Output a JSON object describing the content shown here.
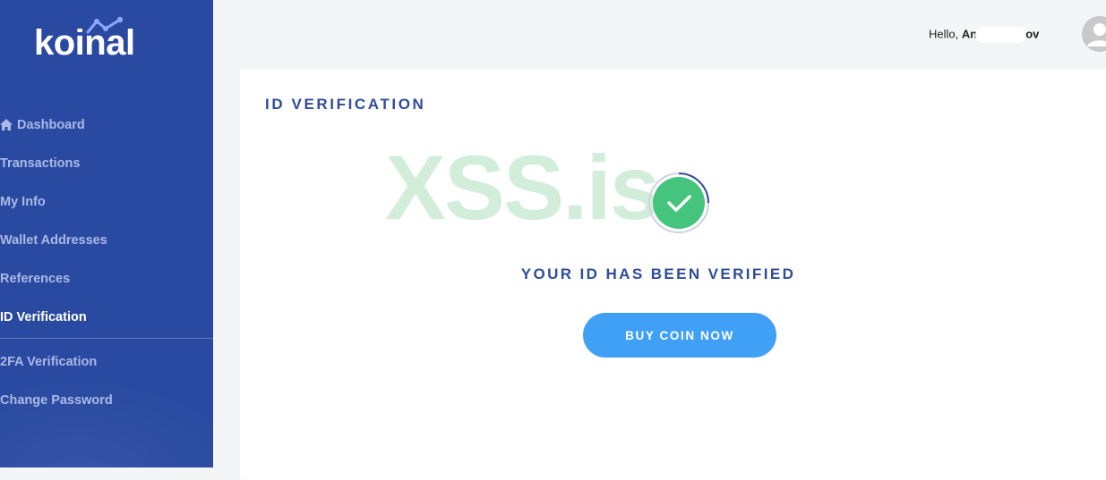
{
  "brand": {
    "name": "koinal"
  },
  "sidebar": {
    "items": [
      {
        "label": "Dashboard",
        "icon": "home-icon"
      },
      {
        "label": "Transactions"
      },
      {
        "label": "My Info"
      },
      {
        "label": "Wallet Addresses"
      },
      {
        "label": "References"
      },
      {
        "label": "ID Verification",
        "active": true
      },
      {
        "label": "2FA Verification"
      },
      {
        "label": "Change Password"
      }
    ]
  },
  "header": {
    "greeting_prefix": "Hello,",
    "user_name_start": "An",
    "user_name_end": "ov"
  },
  "main": {
    "title": "ID VERIFICATION",
    "watermark": "XSS.is",
    "status_message": "YOUR ID HAS BEEN VERIFIED",
    "cta_label": "BUY COIN NOW"
  },
  "colors": {
    "sidebar_bg": "#2a4aa1",
    "accent": "#3fa0f5",
    "heading": "#2f4c9a",
    "success": "#45c47e"
  }
}
